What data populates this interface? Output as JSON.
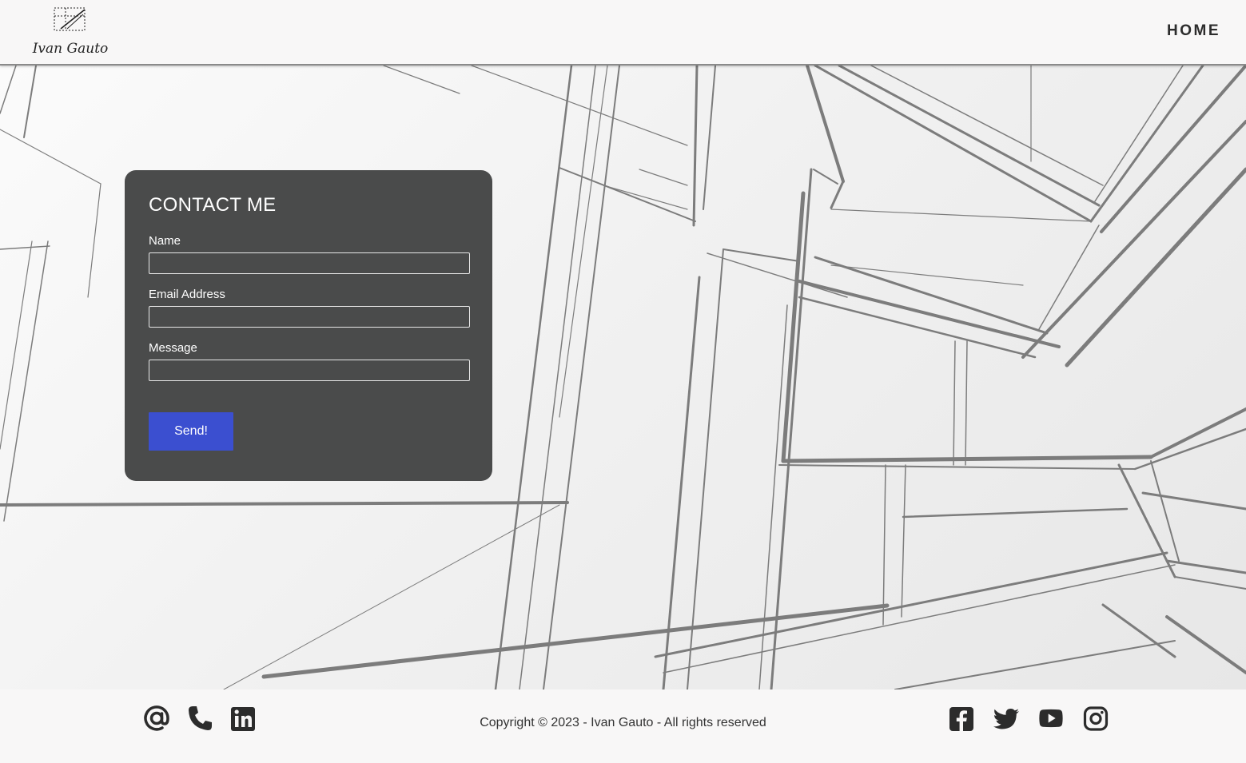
{
  "brand": {
    "logo_text": "Ivan Gauto"
  },
  "nav": {
    "home_label": "HOME"
  },
  "contact": {
    "title": "CONTACT ME",
    "name_label": "Name",
    "email_label": "Email Address",
    "message_label": "Message",
    "name_value": "",
    "email_value": "",
    "message_value": "",
    "send_label": "Send!"
  },
  "footer": {
    "copyright": "Copyright © 2023 - Ivan Gauto - All rights reserved",
    "contact_icons": [
      "at-icon",
      "phone-icon",
      "linkedin-icon"
    ],
    "social_icons": [
      "facebook-icon",
      "twitter-icon",
      "youtube-icon",
      "instagram-icon"
    ]
  },
  "colors": {
    "card_bg": "#4a4b4b",
    "button_bg": "#3b4fd0",
    "page_bg": "#f8f7f7",
    "icon": "#2c2c2c"
  }
}
